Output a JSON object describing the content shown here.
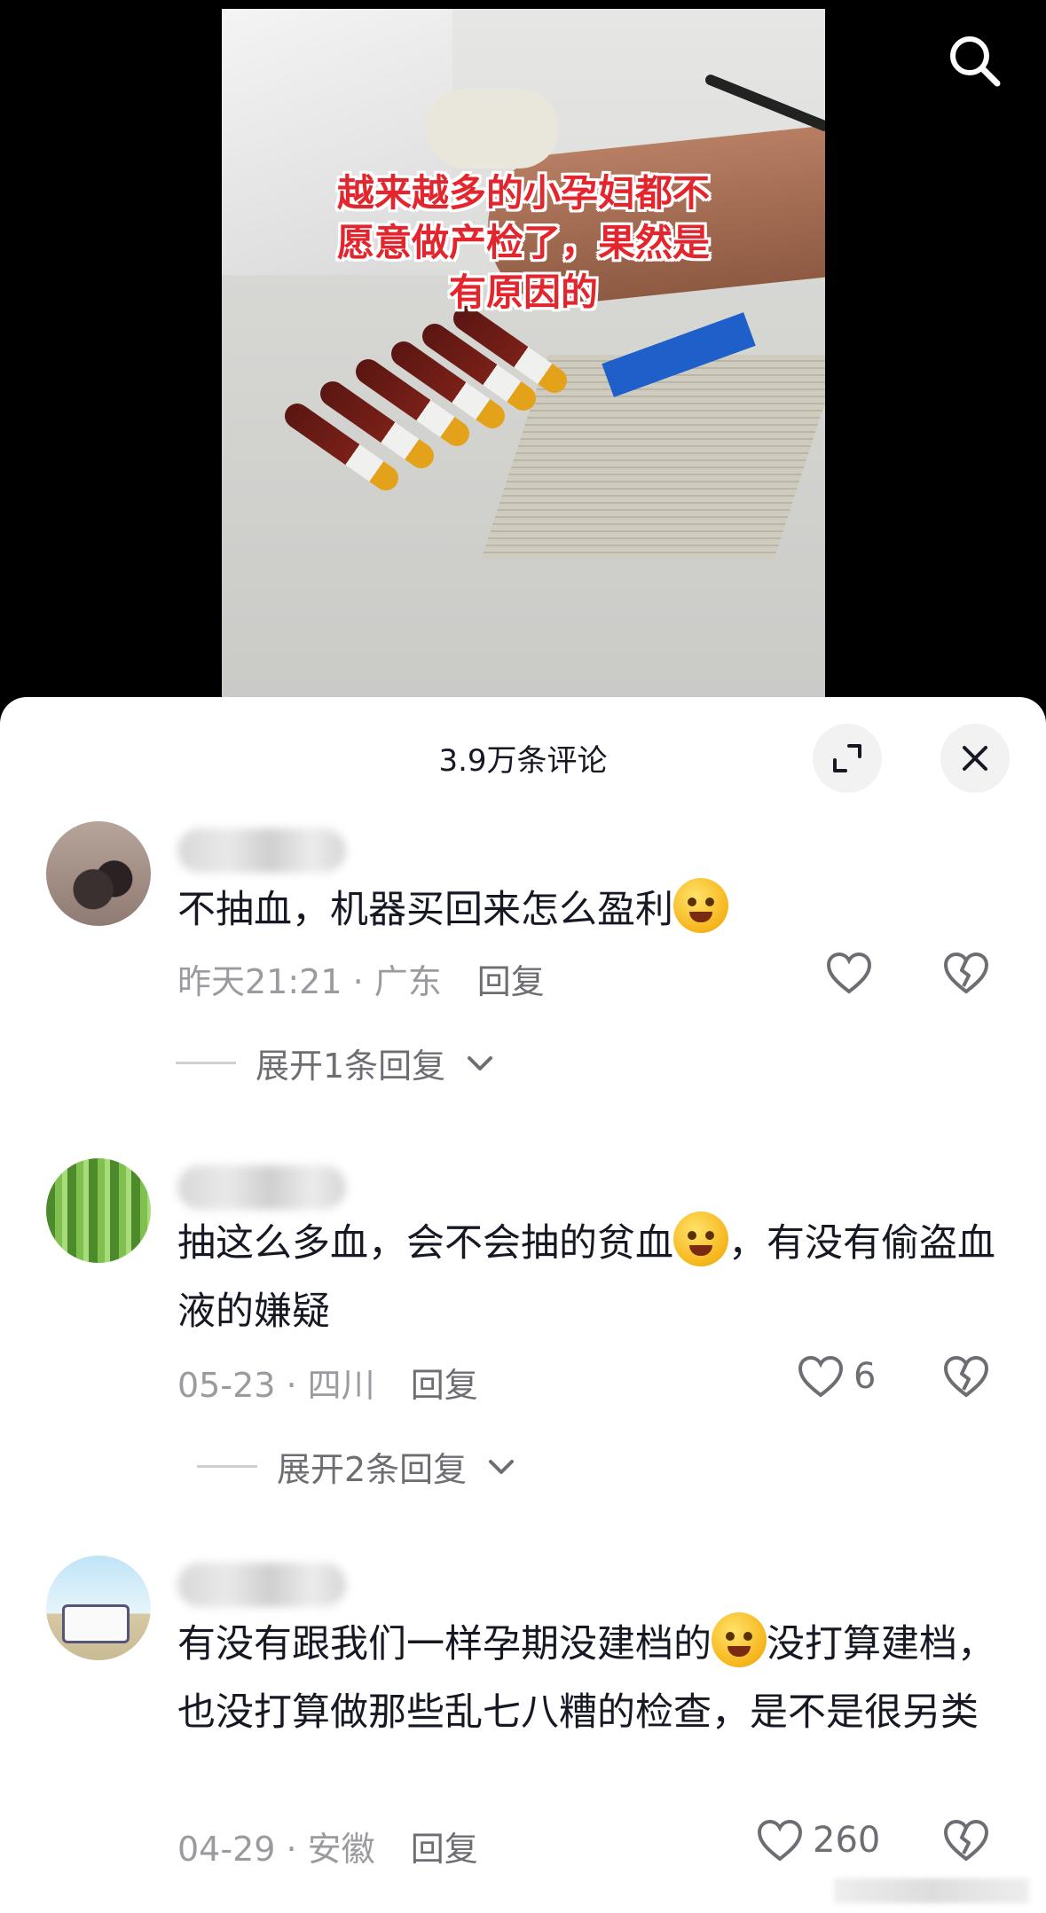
{
  "video": {
    "caption_line1": "越来越多的小孕妇都不",
    "caption_line2": "愿意做产检了，果然是",
    "caption_line3": "有原因的"
  },
  "sheet": {
    "count_label": "3.9万条评论",
    "expand_icon": "expand-icon",
    "close_icon": "close-icon"
  },
  "comments": [
    {
      "text": "不抽血，机器买回来怎么盈利",
      "emoji": "woozy-face",
      "date": "昨天21:21",
      "location": "广东",
      "reply_label": "回复",
      "likes": "",
      "expand_label": "展开1条回复"
    },
    {
      "text_part1": "抽这么多血，会不会抽的贫血",
      "emoji": "crying-laughing-face",
      "text_part2": "，有没有偷盗血液的嫌疑",
      "date": "05-23",
      "location": "四川",
      "reply_label": "回复",
      "likes": "6",
      "expand_label": "展开2条回复"
    },
    {
      "text_part1": "有没有跟我们一样孕期没建档的",
      "emoji": "grinning-face",
      "text_part2": "没打算建档，也没打算做那些乱七八糟的检查，是不是很另类",
      "date": "04-29",
      "location": "安徽",
      "reply_label": "回复",
      "likes": "260"
    }
  ],
  "colors": {
    "caption_red": "#e3262e",
    "text_primary": "#161823",
    "text_secondary": "#9a9ba0"
  }
}
